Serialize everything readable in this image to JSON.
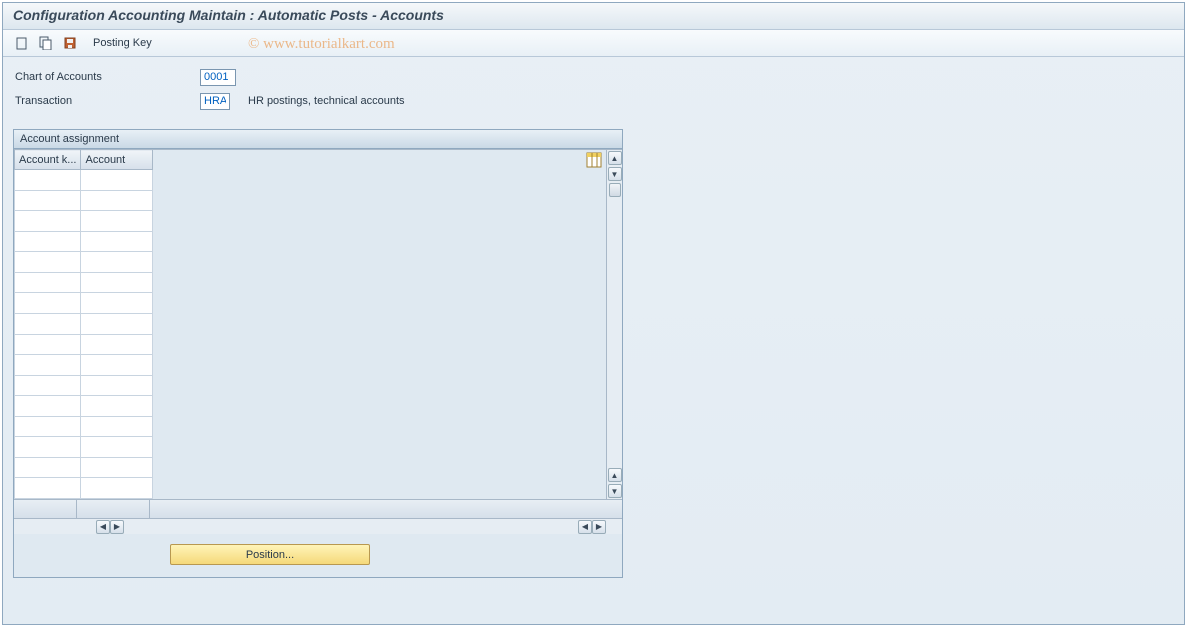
{
  "header": {
    "title": "Configuration Accounting Maintain : Automatic Posts - Accounts"
  },
  "toolbar": {
    "posting_key_label": "Posting Key"
  },
  "form": {
    "chart_of_accounts": {
      "label": "Chart of Accounts",
      "value": "0001"
    },
    "transaction": {
      "label": "Transaction",
      "value": "HRA",
      "desc": "HR postings, technical accounts"
    }
  },
  "panel": {
    "title": "Account assignment",
    "columns": {
      "key": "Account k...",
      "account": "Account"
    }
  },
  "buttons": {
    "position": "Position..."
  },
  "watermark": "© www.tutorialkart.com"
}
